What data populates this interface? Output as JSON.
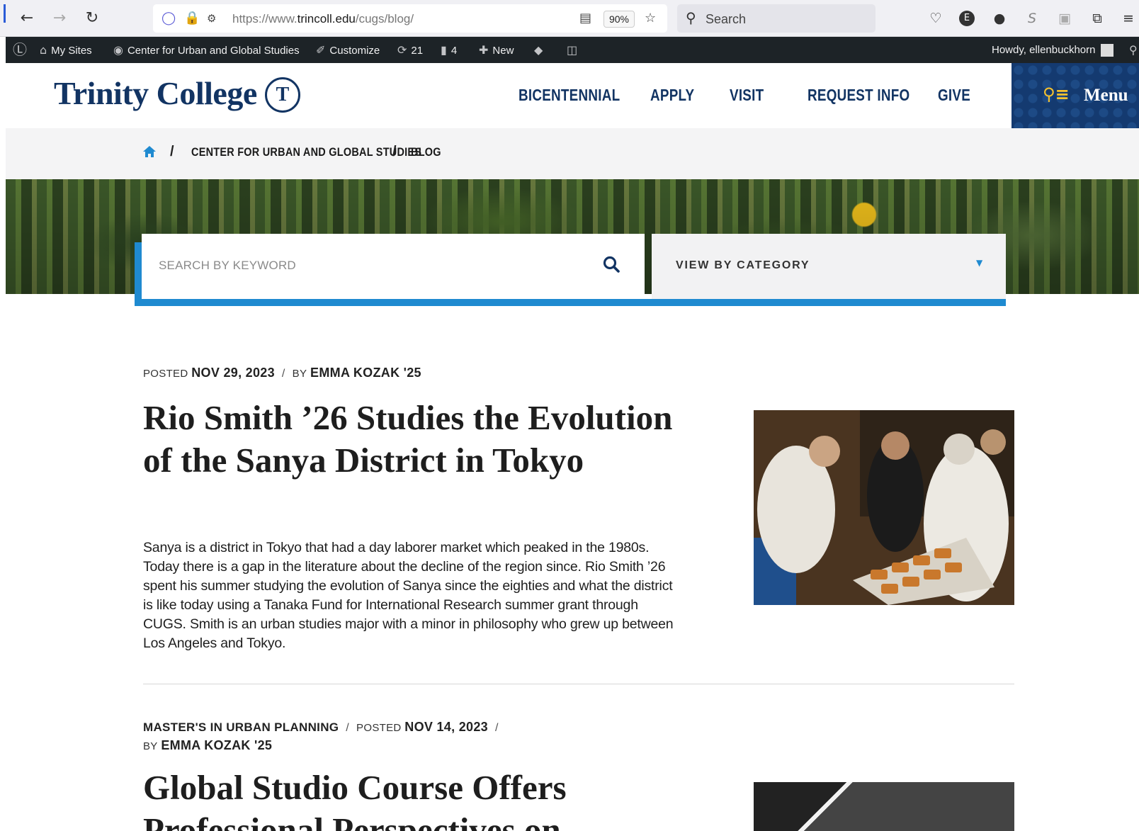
{
  "browser": {
    "url_prefix": "https://www.",
    "url_domain": "trincoll.edu",
    "url_path": "/cugs/blog/",
    "zoom": "90%",
    "search_placeholder": "Search"
  },
  "wp_admin_bar": {
    "my_sites": "My Sites",
    "site_name": "Center for Urban and Global Studies",
    "customize": "Customize",
    "updates_count": "21",
    "comments_count": "4",
    "new_label": "New",
    "howdy": "Howdy, ellenbuckhorn"
  },
  "header": {
    "logo_text": "Trinity College",
    "seal_letter": "T",
    "nav": [
      "BICENTENNIAL",
      "APPLY",
      "VISIT",
      "REQUEST INFO",
      "GIVE"
    ],
    "menu_label": "Menu"
  },
  "breadcrumb": {
    "items": [
      "CENTER FOR URBAN AND GLOBAL STUDIES",
      "BLOG"
    ],
    "separator": "/"
  },
  "search": {
    "keyword_placeholder": "SEARCH BY KEYWORD",
    "category_label": "VIEW BY CATEGORY"
  },
  "posts": [
    {
      "posted_label": "POSTED",
      "date": "NOV 29, 2023",
      "by_label": "BY",
      "author": "EMMA KOZAK '25",
      "title": "Rio Smith ’26 Studies the Evolution of the Sanya District in Tokyo",
      "excerpt": "Sanya is a district in Tokyo that had a day laborer market which peaked in the 1980s. Today there is a gap in the literature about the decline of the region since. Rio Smith ’26 spent his summer studying the evolution of Sanya since the eighties and what the district is like today using a Tanaka Fund for International Research summer grant through CUGS. Smith is an urban studies major with a minor in philosophy who grew up between Los Angeles and Tokyo."
    },
    {
      "category": "MASTER'S IN URBAN PLANNING",
      "posted_label": "POSTED",
      "date": "NOV 14, 2023",
      "by_label": "BY",
      "author": "EMMA KOZAK '25",
      "title": "Global Studio Course Offers Professional Perspectives on"
    }
  ],
  "colors": {
    "navy": "#123463",
    "accent_blue": "#1f8ad0",
    "wp_bar": "#1d2327",
    "menu_icon": "#f5c12e"
  }
}
